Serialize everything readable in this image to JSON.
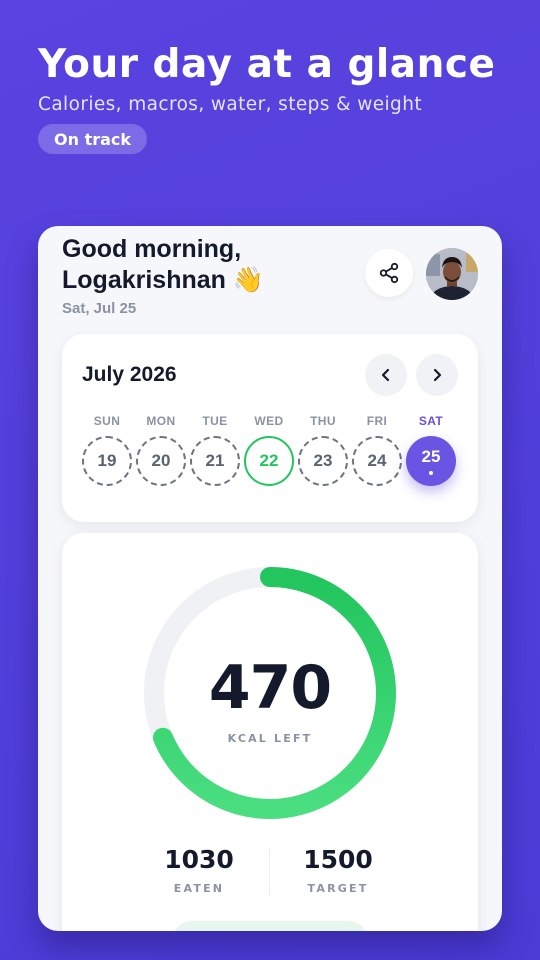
{
  "promo": {
    "headline": "Your day at a glance",
    "subline": "Calories, macros, water, steps & weight",
    "badge": "On track"
  },
  "header": {
    "greeting_line1": "Good morning,",
    "greeting_line2": "Logakrishnan 👋",
    "date": "Sat, Jul 25",
    "share_icon": "share-icon"
  },
  "calendar": {
    "month_label": "July 2026",
    "days": [
      {
        "name": "SUN",
        "num": "19"
      },
      {
        "name": "MON",
        "num": "20"
      },
      {
        "name": "TUE",
        "num": "21"
      },
      {
        "name": "WED",
        "num": "22"
      },
      {
        "name": "THU",
        "num": "23"
      },
      {
        "name": "FRI",
        "num": "24"
      },
      {
        "name": "SAT",
        "num": "25"
      }
    ],
    "today_index": 3,
    "selected_index": 6
  },
  "calories": {
    "remaining": "470",
    "remaining_label": "KCAL LEFT",
    "eaten": "1030",
    "eaten_label": "EATEN",
    "target": "1500",
    "target_label": "TARGET",
    "progress_fraction": 0.687
  },
  "colors": {
    "background": "#5340dc",
    "accent": "#6a54e4",
    "progress_green": "#22c55e"
  }
}
